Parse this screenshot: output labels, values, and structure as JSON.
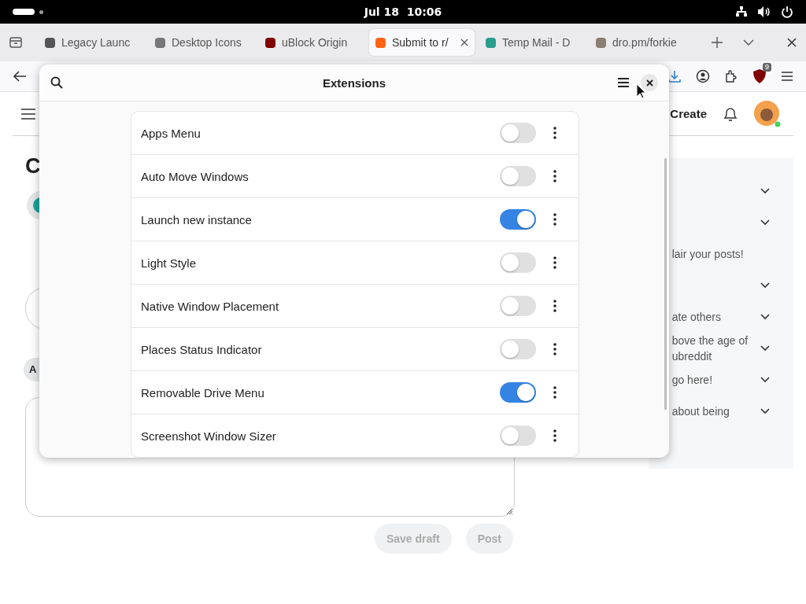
{
  "top_bar": {
    "clock": "Jul 18  10:06"
  },
  "tabs": [
    {
      "label": "Legacy Launc",
      "selected": false,
      "color": "#555555"
    },
    {
      "label": "Desktop Icons",
      "selected": false,
      "color": "#777777"
    },
    {
      "label": "uBlock Origin",
      "selected": false,
      "color": "#800000"
    },
    {
      "label": "Submit to r/",
      "selected": true,
      "color": "#ff6314"
    },
    {
      "label": "Temp Mail - D",
      "selected": false,
      "color": "#2a9d8f"
    },
    {
      "label": "dro.pm/forkie",
      "selected": false,
      "color": "#8a7f72"
    }
  ],
  "toolbar": {
    "extension_badge": "9"
  },
  "page": {
    "create": "Create",
    "heading": "C",
    "chip": "A",
    "buttons": [
      {
        "label": "Save draft",
        "disabled": true
      },
      {
        "label": "Post",
        "disabled": true
      }
    ],
    "sidebar": [
      {
        "kind": "rule"
      },
      {
        "kind": "rule"
      },
      {
        "kind": "note",
        "lines": [
          "lair your posts!"
        ]
      },
      {
        "kind": "rule"
      },
      {
        "kind": "rule",
        "lines": [
          "ate others"
        ]
      },
      {
        "kind": "rule",
        "lines": [
          "bove the age of",
          "ubreddit"
        ]
      },
      {
        "kind": "rule",
        "lines": [
          "go here!"
        ]
      },
      {
        "kind": "rule",
        "lines": [
          "about being"
        ]
      }
    ]
  },
  "dialog": {
    "title": "Extensions",
    "extensions": [
      {
        "name": "Apps Menu",
        "on": false
      },
      {
        "name": "Auto Move Windows",
        "on": false
      },
      {
        "name": "Launch new instance",
        "on": true
      },
      {
        "name": "Light Style",
        "on": false
      },
      {
        "name": "Native Window Placement",
        "on": false
      },
      {
        "name": "Places Status Indicator",
        "on": false
      },
      {
        "name": "Removable Drive Menu",
        "on": true
      },
      {
        "name": "Screenshot Window Sizer",
        "on": false
      }
    ]
  }
}
